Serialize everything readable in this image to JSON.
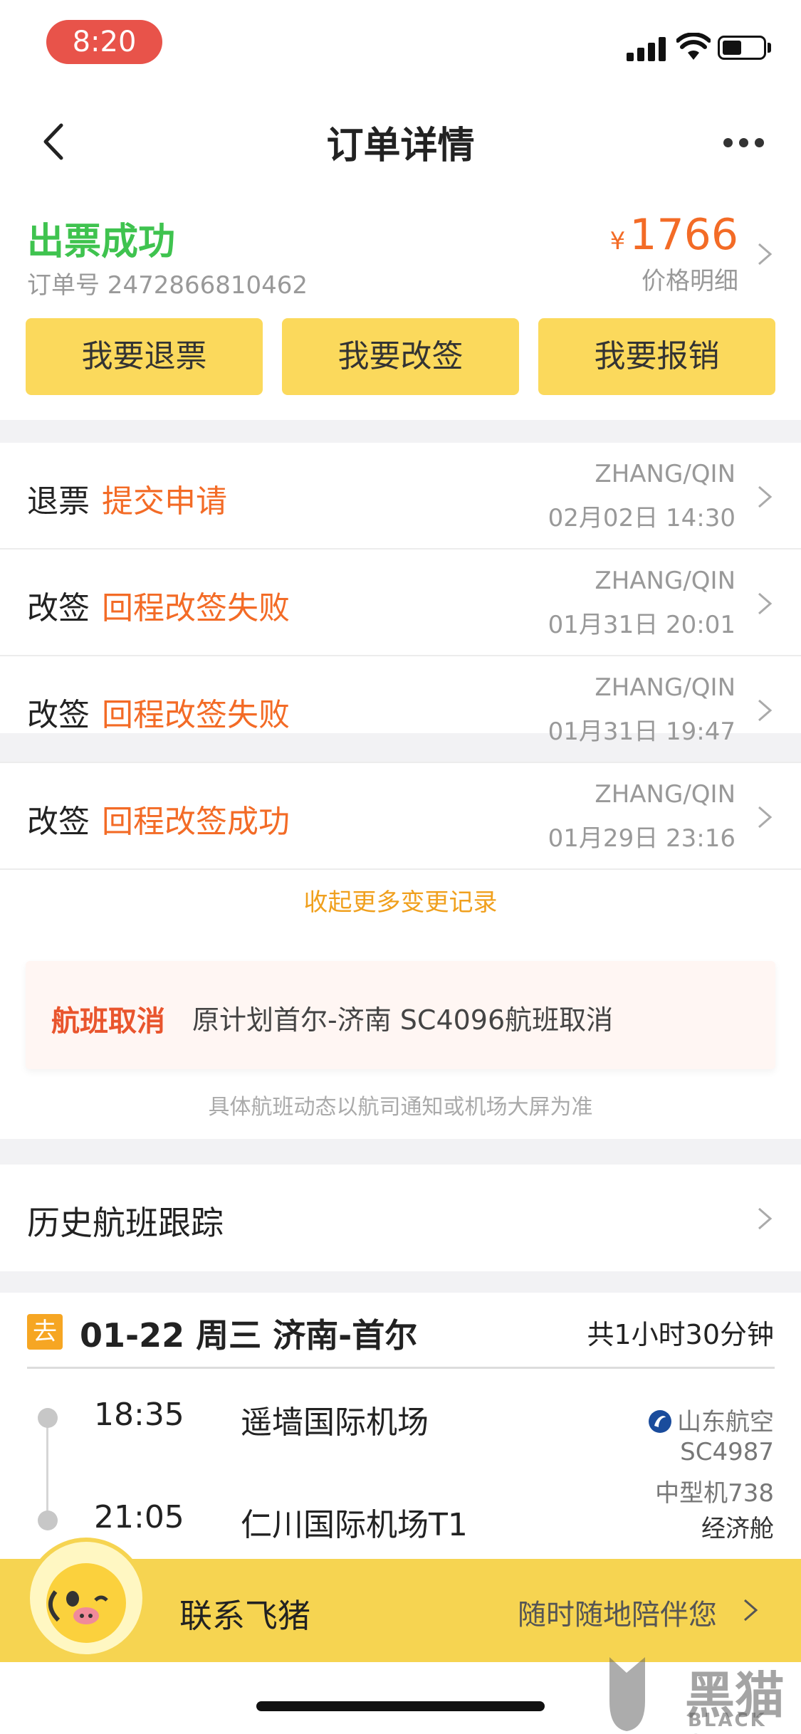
{
  "status_bar": {
    "time": "8:20"
  },
  "nav": {
    "title": "订单详情"
  },
  "summary": {
    "status": "出票成功",
    "order_number": "订单号 2472866810462",
    "currency": "¥",
    "price": "1766",
    "price_detail": "价格明细",
    "buttons": [
      "我要退票",
      "我要改签",
      "我要报销"
    ]
  },
  "records": [
    {
      "type": "退票",
      "status": "提交申请",
      "passenger": "ZHANG/QIN",
      "time": "02月02日 14:30"
    },
    {
      "type": "改签",
      "status": "回程改签失败",
      "passenger": "ZHANG/QIN",
      "time": "01月31日 20:01"
    },
    {
      "type": "改签",
      "status": "回程改签失败",
      "passenger": "ZHANG/QIN",
      "time": "01月31日 19:47"
    },
    {
      "type": "改签",
      "status": "回程改签成功",
      "passenger": "ZHANG/QIN",
      "time": "01月29日 23:16"
    }
  ],
  "collapse_label": "收起更多变更记录",
  "notice": {
    "tag": "航班取消",
    "text": "原计划首尔-济南 SC4096航班取消",
    "footnote": "具体航班动态以航司通知或机场大屏为准"
  },
  "history": {
    "label": "历史航班跟踪"
  },
  "flight": {
    "badge": "去",
    "date_route": "01-22 周三 济南-首尔",
    "duration": "共1小时30分钟",
    "depart_time": "18:35",
    "depart_airport": "遥墙国际机场",
    "arrive_time": "21:05",
    "arrive_airport": "仁川国际机场T1",
    "airline": "山东航空",
    "flight_no": "SC4987",
    "aircraft": "中型机738",
    "cabin": "经济舱"
  },
  "banner": {
    "label": "联系飞猪",
    "right_text": "随时随地陪伴您"
  },
  "watermark": {
    "text": "黑猫",
    "sub": "BLACK CAT"
  },
  "colors": {
    "accent_yellow": "#fbd95c",
    "success_green": "#3fc34f",
    "price_orange": "#f36b26"
  }
}
